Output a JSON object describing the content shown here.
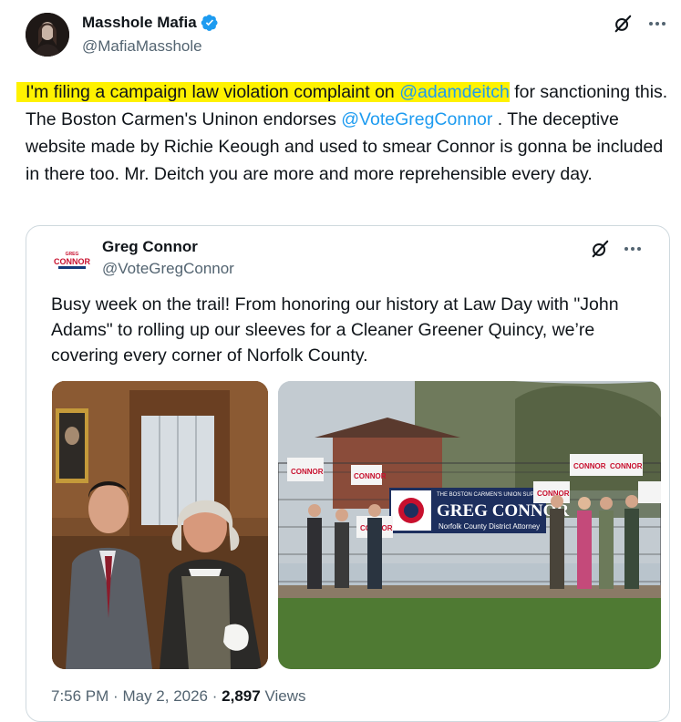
{
  "post": {
    "author_name": "Masshole Mafia",
    "author_handle": "@MafiaMasshole",
    "text_highlighted": "I'm filing a campaign law violation complaint on ",
    "mention_1": "@adamdeitch",
    "text_part_2": " for sanctioning this. The Boston Carmen's Uninon endorses ",
    "mention_2": "@VoteGregConnor",
    "text_part_3": " . The deceptive website made by Richie Keough and used to smear Connor is gonna be included in there too. Mr. Deitch you are more and more reprehensible every day."
  },
  "quoted_post": {
    "logo_small": "GREG",
    "logo_big": "CONNOR",
    "author_name": "Greg Connor",
    "author_handle": "@VoteGregConnor",
    "text": "Busy week on the trail! From honoring our history at Law Day with \"John Adams\" to rolling up our sleeves for a Cleaner Greener Quincy, we’re covering every corner of Norfolk County.",
    "time": "7:56 PM",
    "separator": "·",
    "date": "May 2, 2026",
    "views_count": "2,897",
    "views_label": "Views",
    "banner": {
      "union_line": "THE BOSTON CARMEN'S UNION SUPPORTS",
      "name": "GREG CONNOR",
      "subtitle": "Norfolk County District Attorney"
    },
    "sign_label": "CONNOR"
  },
  "icons": {
    "grok": "grok-icon",
    "more": "more-icon",
    "verified": "verified-badge-icon"
  },
  "colors": {
    "link": "#1d9bf0",
    "highlight": "#fff200",
    "banner_blue": "#1d2f5e",
    "brand_red": "#c8102e"
  }
}
